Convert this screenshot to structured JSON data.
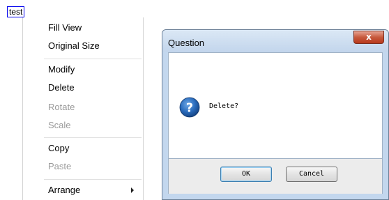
{
  "selection_label": "test",
  "context_menu": {
    "items": [
      {
        "label": "Fill View",
        "enabled": true
      },
      {
        "label": "Original Size",
        "enabled": true
      },
      {
        "label": "Modify",
        "enabled": true
      },
      {
        "label": "Delete",
        "enabled": true
      },
      {
        "label": "Rotate",
        "enabled": false
      },
      {
        "label": "Scale",
        "enabled": false
      },
      {
        "label": "Copy",
        "enabled": true
      },
      {
        "label": "Paste",
        "enabled": false
      },
      {
        "label": "Arrange",
        "enabled": true,
        "has_submenu": true
      }
    ]
  },
  "dialog": {
    "title": "Question",
    "close_label": "x",
    "message": "Delete?",
    "icon": "question-icon",
    "ok_label": "OK",
    "cancel_label": "Cancel"
  },
  "colors": {
    "selection_border": "#0000ee",
    "close_button": "#c75a3d",
    "icon_blue": "#1f5fa8",
    "disabled_text": "#9a9a9a"
  }
}
